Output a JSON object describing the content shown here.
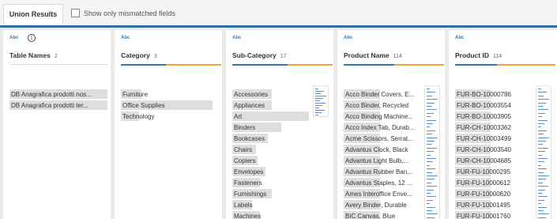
{
  "header": {
    "title": "Union Results",
    "mismatch_label": "Show only mismatched fields"
  },
  "columns": [
    {
      "type": "Abc",
      "name": "Table Names",
      "count": "2",
      "has_info_icon": true,
      "rows": [
        {
          "label": "DB Anagrafica prodotti nos...",
          "fill": 1.0
        },
        {
          "label": "DB Anagrafica prodotti ter...",
          "fill": 1.0
        }
      ]
    },
    {
      "type": "Abc",
      "name": "Category",
      "count": "3",
      "rows": [
        {
          "label": "Furniture",
          "fill": 0.22
        },
        {
          "label": "Office Supplies",
          "fill": 1.0
        },
        {
          "label": "Technology",
          "fill": 0.2
        }
      ]
    },
    {
      "type": "Abc",
      "name": "Sub-Category",
      "count": "17",
      "rows": [
        {
          "label": "Accessories",
          "fill": 0.5
        },
        {
          "label": "Appliances",
          "fill": 0.5
        },
        {
          "label": "Art",
          "fill": 0.97
        },
        {
          "label": "Binders",
          "fill": 0.62
        },
        {
          "label": "Bookcases",
          "fill": 0.45
        },
        {
          "label": "Chairs",
          "fill": 0.3
        },
        {
          "label": "Copiers",
          "fill": 0.32
        },
        {
          "label": "Envelopes",
          "fill": 0.42
        },
        {
          "label": "Fasteners",
          "fill": 0.35
        },
        {
          "label": "Furnishings",
          "fill": 0.5
        },
        {
          "label": "Labels",
          "fill": 0.25
        },
        {
          "label": "Machines",
          "fill": 0.35
        }
      ]
    },
    {
      "type": "Abc",
      "name": "Product Name",
      "count": "114",
      "rows": [
        {
          "label": "Acco Binder Covers, E...",
          "fill": 0.5
        },
        {
          "label": "Acco Binder, Recycled",
          "fill": 0.5
        },
        {
          "label": "Acco Binding Machine...",
          "fill": 0.5
        },
        {
          "label": "Acco Index Tab, Durab...",
          "fill": 0.5
        },
        {
          "label": "Acme Scissors, Serrat...",
          "fill": 0.5
        },
        {
          "label": "Advantus Clock, Black",
          "fill": 0.5
        },
        {
          "label": "Advantus Light Bulb,...",
          "fill": 0.5
        },
        {
          "label": "Advantus Rubber Ban...",
          "fill": 0.5
        },
        {
          "label": "Advantus Staples, 12 ...",
          "fill": 0.5
        },
        {
          "label": "Ames Interoffice Enve...",
          "fill": 0.5
        },
        {
          "label": "Avery Binder, Durable",
          "fill": 0.5
        },
        {
          "label": "BIC Canvas, Blue",
          "fill": 0.5
        }
      ]
    },
    {
      "type": "Abc",
      "name": "Product ID",
      "count": "114",
      "rows": [
        {
          "label": "FUR-BO-10000786",
          "fill": 0.5
        },
        {
          "label": "FUR-BO-10003554",
          "fill": 0.5
        },
        {
          "label": "FUR-BO-10003905",
          "fill": 0.5
        },
        {
          "label": "FUR-CH-10003362",
          "fill": 0.5
        },
        {
          "label": "FUR-CH-10003499",
          "fill": 0.5
        },
        {
          "label": "FUR-CH-10003540",
          "fill": 0.5
        },
        {
          "label": "FUR-CH-10004685",
          "fill": 0.5
        },
        {
          "label": "FUR-FU-10000295",
          "fill": 0.5
        },
        {
          "label": "FUR-FU-10000612",
          "fill": 0.5
        },
        {
          "label": "FUR-FU-10000620",
          "fill": 0.5
        },
        {
          "label": "FUR-FU-10001495",
          "fill": 0.5
        },
        {
          "label": "FUR-FU-10001760",
          "fill": 0.5
        }
      ]
    }
  ],
  "colors": {
    "accent_blue": "#2e6f9e",
    "type_blue": "#2e7bb4",
    "orange": "#f0a23c",
    "bar_gray": "#dedede"
  }
}
